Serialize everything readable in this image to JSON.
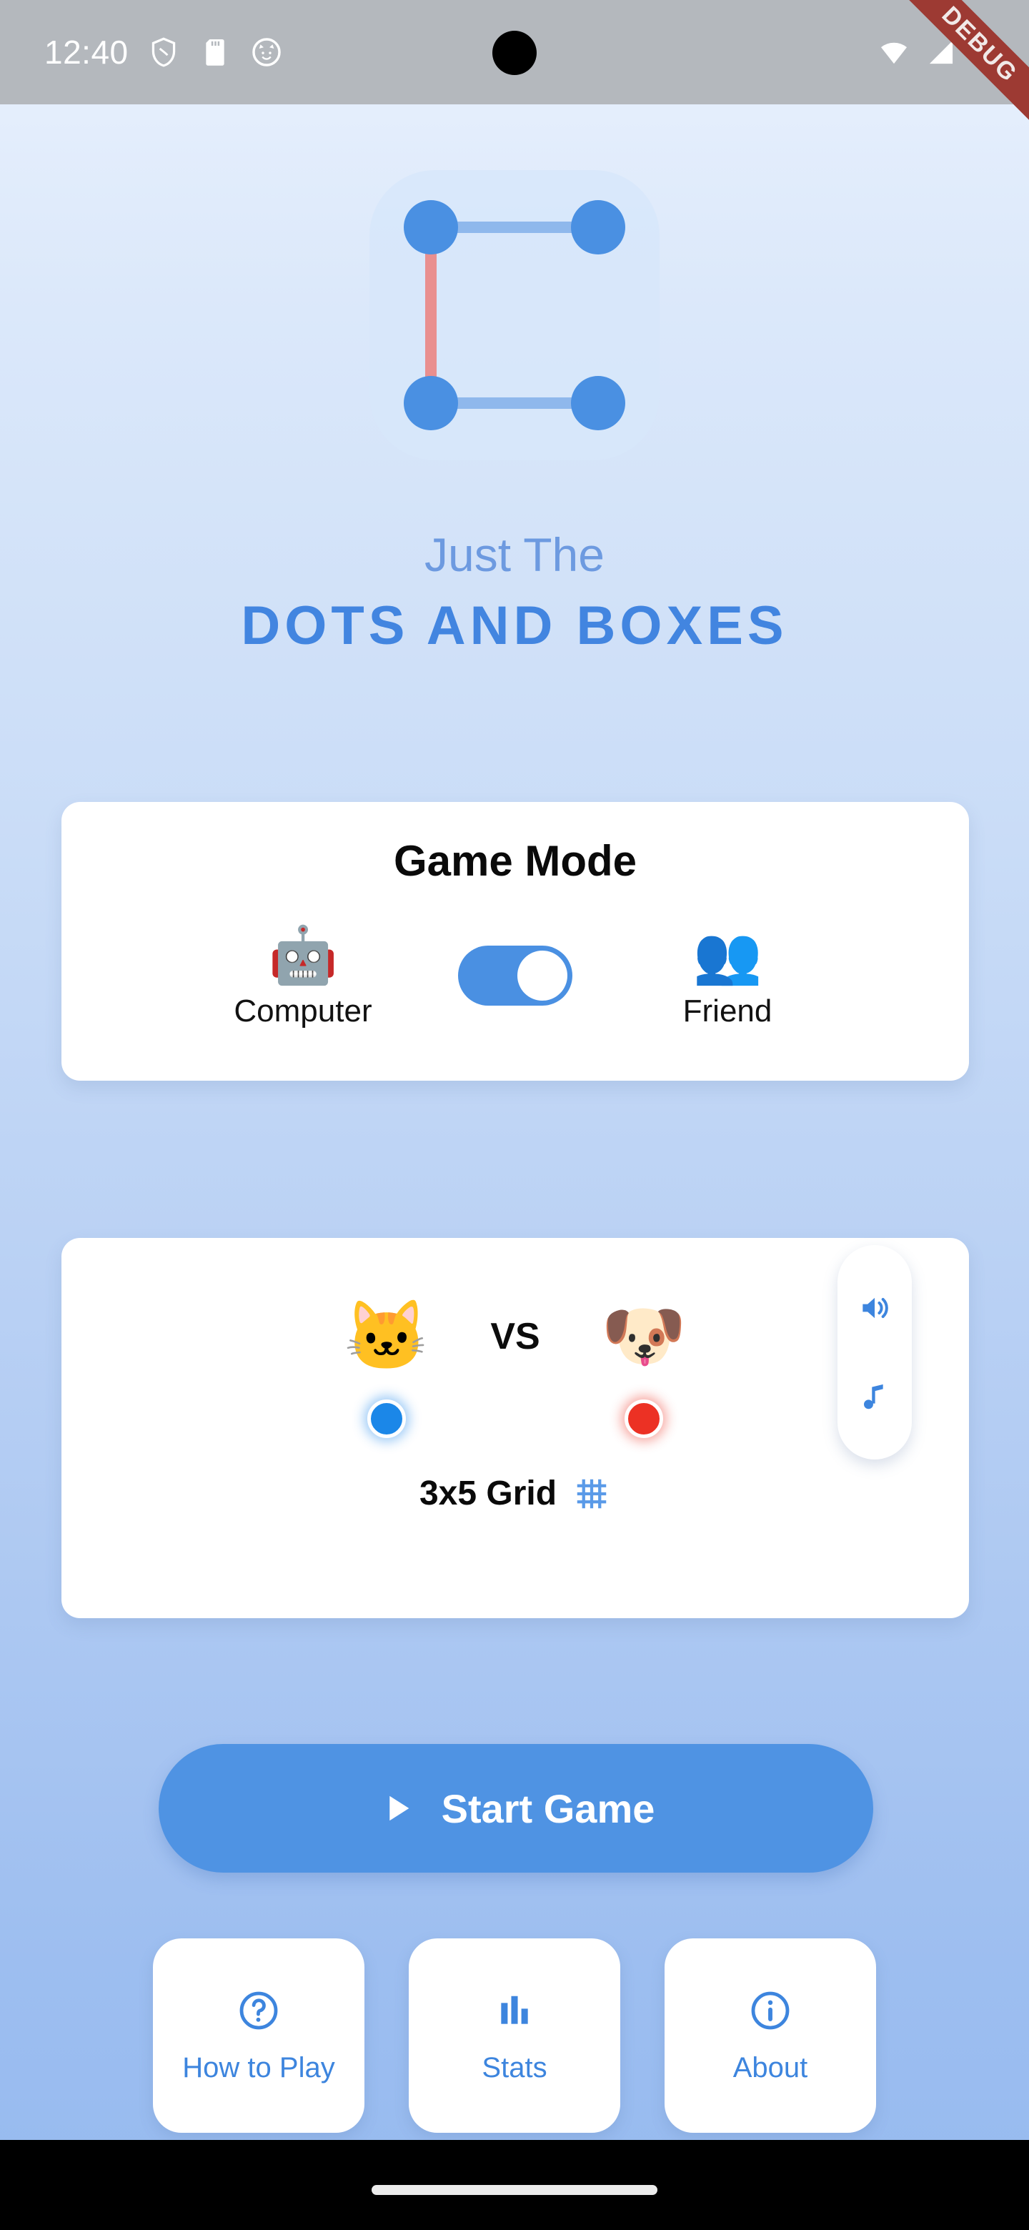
{
  "status_bar": {
    "time": "12:40",
    "left_icons": [
      "shield-icon",
      "sd-card-icon",
      "cat-face-icon"
    ],
    "right_icons": [
      "wifi-icon",
      "cellular-signal-icon",
      "battery-icon"
    ],
    "background_color": "#b4b8bd"
  },
  "debug_banner": {
    "label": "DEBUG",
    "color": "#9d3a33"
  },
  "logo": {
    "name": "dots-and-boxes-logo",
    "dot_color": "#4a90e2",
    "line_color": "#8fb8ec",
    "accent_line_color": "#e98f8f",
    "tile_color": "#d7e7fa"
  },
  "title": {
    "small": "Just The",
    "big": "DOTS AND BOXES",
    "small_color": "#6d9ae0",
    "big_color": "#4285e0"
  },
  "game_mode": {
    "heading": "Game Mode",
    "left_option": {
      "label": "Computer",
      "emoji": "🤖"
    },
    "right_option": {
      "label": "Friend",
      "emoji": "👥"
    },
    "toggle": {
      "state": "on",
      "selected": "Friend",
      "color": "#4a90e2"
    }
  },
  "match": {
    "player_one": {
      "emoji": "🐱",
      "color": "#1b87e8"
    },
    "player_two": {
      "emoji": "🐶",
      "color": "#ec3124"
    },
    "vs_label": "VS",
    "grid_label": "3x5 Grid",
    "grid_icon": "grid-icon"
  },
  "side_panel": {
    "buttons": [
      {
        "name": "sound-toggle",
        "icon": "volume-up-icon"
      },
      {
        "name": "music-toggle",
        "icon": "music-note-icon"
      }
    ],
    "icon_color": "#3d85de"
  },
  "start_button": {
    "label": "Start Game",
    "icon": "play-icon",
    "color": "#4f93e3"
  },
  "bottom_buttons": [
    {
      "label": "How to Play",
      "icon": "help-circle-icon"
    },
    {
      "label": "Stats",
      "icon": "bar-chart-icon"
    },
    {
      "label": "About",
      "icon": "info-circle-icon"
    }
  ],
  "nav_bar": {
    "home_indicator": "home-indicator"
  }
}
